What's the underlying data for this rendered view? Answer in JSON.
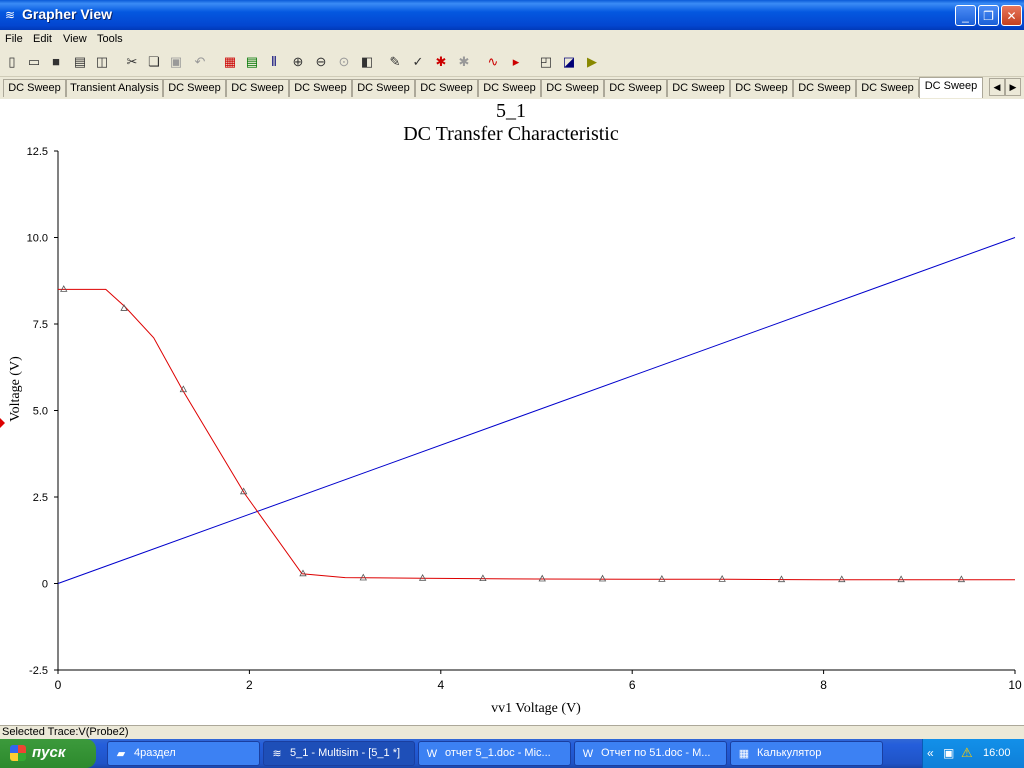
{
  "window": {
    "title": "Grapher View"
  },
  "menu": [
    "File",
    "Edit",
    "View",
    "Tools"
  ],
  "tabs": [
    "DC Sweep",
    "Transient Analysis",
    "DC Sweep",
    "DC Sweep",
    "DC Sweep",
    "DC Sweep",
    "DC Sweep",
    "DC Sweep",
    "DC Sweep",
    "DC Sweep",
    "DC Sweep",
    "DC Sweep",
    "DC Sweep",
    "DC Sweep",
    "DC Sweep"
  ],
  "status": {
    "text": "Selected Trace:V(Probe2)"
  },
  "taskbar": {
    "start": "пуск",
    "items": [
      "4раздел",
      "5_1 - Multisim - [5_1 *]",
      "отчет 5_1.doc - Mic...",
      "Отчет по 51.doc - M...",
      "Калькулятор"
    ],
    "clock": "16:00"
  },
  "chart_data": {
    "type": "line",
    "title": "5_1",
    "subtitle": "DC Transfer Characteristic",
    "xlabel": "vv1 Voltage (V)",
    "ylabel": "Voltage (V)",
    "xlim": [
      0,
      10
    ],
    "ylim": [
      -2.5,
      12.5
    ],
    "xticks": [
      "0",
      "2",
      "4",
      "6",
      "8",
      "10"
    ],
    "yticks": [
      "-2.5",
      "0",
      "2.5",
      "5.0",
      "7.5",
      "10.0",
      "12.5"
    ],
    "grid": false,
    "series": [
      {
        "color": "#0000cc",
        "x": [
          0,
          10
        ],
        "y": [
          0,
          10
        ]
      },
      {
        "color": "#dd0000",
        "x": [
          0,
          0.5,
          0.7,
          1.0,
          1.3,
          1.95,
          2.55,
          3.0,
          3.8,
          5,
          6,
          7,
          8,
          9,
          10
        ],
        "y": [
          8.5,
          8.5,
          8.0,
          7.1,
          5.6,
          2.6,
          0.28,
          0.17,
          0.15,
          0.13,
          0.12,
          0.12,
          0.11,
          0.11,
          0.11
        ],
        "markers_x": [
          0.06,
          0.69,
          1.31,
          1.94,
          2.56,
          3.19,
          3.81,
          4.44,
          5.06,
          5.69,
          6.31,
          6.94,
          7.56,
          8.19,
          8.81,
          9.44
        ],
        "markers_y": [
          8.5,
          7.95,
          5.6,
          2.65,
          0.28,
          0.16,
          0.15,
          0.14,
          0.13,
          0.13,
          0.12,
          0.12,
          0.11,
          0.11,
          0.11,
          0.11
        ]
      }
    ]
  }
}
